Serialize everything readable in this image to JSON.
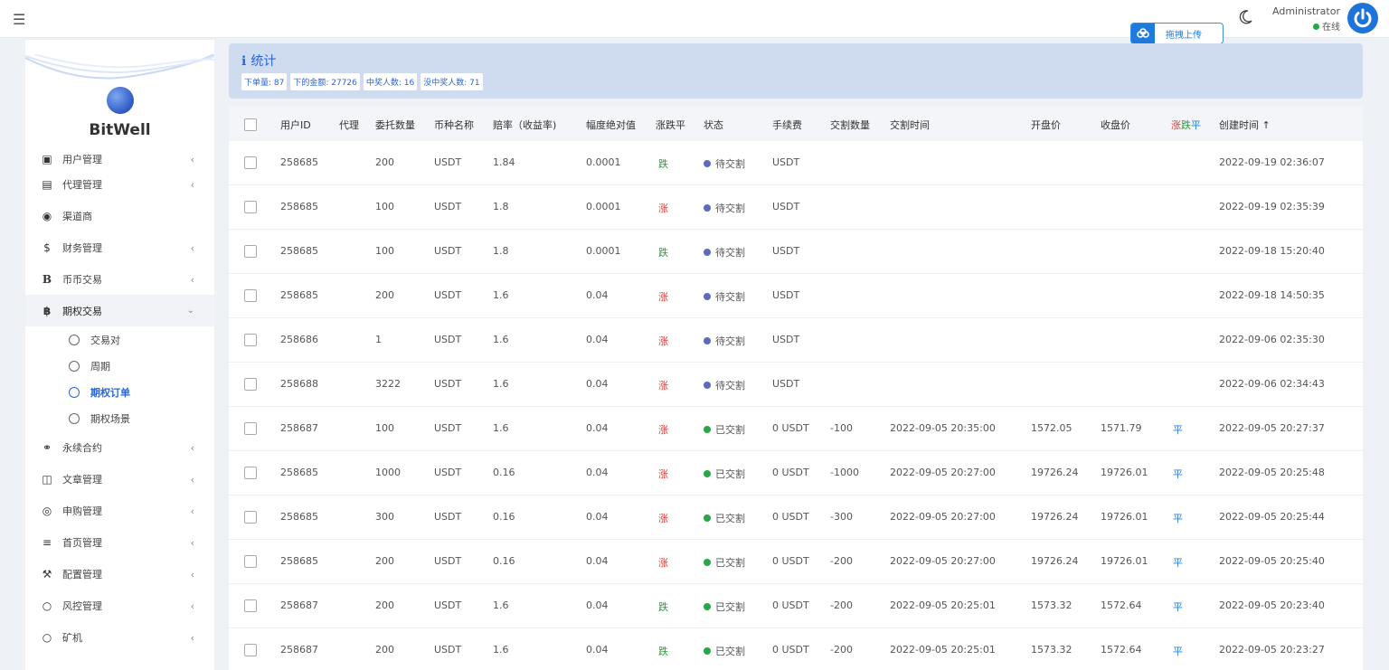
{
  "topbar": {
    "menu_icon": "hamburger-icon",
    "upload_label": "拖拽上传",
    "admin_name": "Administrator",
    "admin_status": "在线"
  },
  "brand": {
    "name": "BitWell"
  },
  "menu": [
    {
      "label": "用户管理",
      "icon": "users-icon"
    },
    {
      "label": "代理管理",
      "icon": "id-card-icon"
    },
    {
      "label": "渠道商",
      "icon": "user-circle-icon"
    },
    {
      "label": "财务管理",
      "icon": "dollar-icon"
    },
    {
      "label": "币币交易",
      "icon": "b-icon"
    },
    {
      "label": "期权交易",
      "icon": "bitcoin-icon"
    },
    {
      "label": "永续合约",
      "icon": "link-icon"
    },
    {
      "label": "文章管理",
      "icon": "newspaper-icon"
    },
    {
      "label": "申购管理",
      "icon": "lifebuoy-icon"
    },
    {
      "label": "首页管理",
      "icon": "bars-icon"
    },
    {
      "label": "配置管理",
      "icon": "wrench-icon"
    },
    {
      "label": "风控管理",
      "icon": "circle-icon"
    },
    {
      "label": "矿机",
      "icon": "circle-icon"
    }
  ],
  "submenu": [
    "交易对",
    "周期",
    "期权订单",
    "期权场景"
  ],
  "stats": {
    "title": "统计",
    "badges": [
      "下单量: 87",
      "下的金额: 27726",
      "中奖人数: 16",
      "没中奖人数: 71"
    ]
  },
  "columns": [
    "用户ID",
    "代理",
    "委托数量",
    "币种名称",
    "赔率（收益率)",
    "幅度绝对值",
    "涨跌平",
    "状态",
    "手续费",
    "交割数量",
    "交割时间",
    "开盘价",
    "收盘价",
    "涨",
    "跌",
    "平",
    "创建时间 ↑"
  ],
  "rows": [
    {
      "uid": "258685",
      "qty": "200",
      "coin": "USDT",
      "odds": "1.84",
      "amp": "0.0001",
      "dir": "跌",
      "dir_class": "down",
      "status": "待交割",
      "status_color": "#5c6bc0",
      "fee": "USDT",
      "dqty": "",
      "dtime": "",
      "open": "",
      "close": "",
      "res": "",
      "created": "2022-09-19 02:36:07"
    },
    {
      "uid": "258685",
      "qty": "100",
      "coin": "USDT",
      "odds": "1.8",
      "amp": "0.0001",
      "dir": "涨",
      "dir_class": "up",
      "status": "待交割",
      "status_color": "#5c6bc0",
      "fee": "USDT",
      "dqty": "",
      "dtime": "",
      "open": "",
      "close": "",
      "res": "",
      "created": "2022-09-19 02:35:39"
    },
    {
      "uid": "258685",
      "qty": "100",
      "coin": "USDT",
      "odds": "1.8",
      "amp": "0.0001",
      "dir": "跌",
      "dir_class": "down",
      "status": "待交割",
      "status_color": "#5c6bc0",
      "fee": "USDT",
      "dqty": "",
      "dtime": "",
      "open": "",
      "close": "",
      "res": "",
      "created": "2022-09-18 15:20:40"
    },
    {
      "uid": "258685",
      "qty": "200",
      "coin": "USDT",
      "odds": "1.6",
      "amp": "0.04",
      "dir": "涨",
      "dir_class": "up",
      "status": "待交割",
      "status_color": "#5c6bc0",
      "fee": "USDT",
      "dqty": "",
      "dtime": "",
      "open": "",
      "close": "",
      "res": "",
      "created": "2022-09-18 14:50:35"
    },
    {
      "uid": "258686",
      "qty": "1",
      "coin": "USDT",
      "odds": "1.6",
      "amp": "0.04",
      "dir": "涨",
      "dir_class": "up",
      "status": "待交割",
      "status_color": "#5c6bc0",
      "fee": "USDT",
      "dqty": "",
      "dtime": "",
      "open": "",
      "close": "",
      "res": "",
      "created": "2022-09-06 02:35:30"
    },
    {
      "uid": "258688",
      "qty": "3222",
      "coin": "USDT",
      "odds": "1.6",
      "amp": "0.04",
      "dir": "涨",
      "dir_class": "up",
      "status": "待交割",
      "status_color": "#5c6bc0",
      "fee": "USDT",
      "dqty": "",
      "dtime": "",
      "open": "",
      "close": "",
      "res": "",
      "created": "2022-09-06 02:34:43"
    },
    {
      "uid": "258687",
      "qty": "100",
      "coin": "USDT",
      "odds": "1.6",
      "amp": "0.04",
      "dir": "涨",
      "dir_class": "up",
      "status": "已交割",
      "status_color": "#28a745",
      "fee": "0 USDT",
      "dqty": "-100",
      "dtime": "2022-09-05 20:35:00",
      "open": "1572.05",
      "close": "1571.79",
      "res": "平",
      "created": "2022-09-05 20:27:37"
    },
    {
      "uid": "258685",
      "qty": "1000",
      "coin": "USDT",
      "odds": "0.16",
      "amp": "0.04",
      "dir": "涨",
      "dir_class": "up",
      "status": "已交割",
      "status_color": "#28a745",
      "fee": "0 USDT",
      "dqty": "-1000",
      "dtime": "2022-09-05 20:27:00",
      "open": "19726.24",
      "close": "19726.01",
      "res": "平",
      "created": "2022-09-05 20:25:48"
    },
    {
      "uid": "258685",
      "qty": "300",
      "coin": "USDT",
      "odds": "0.16",
      "amp": "0.04",
      "dir": "涨",
      "dir_class": "up",
      "status": "已交割",
      "status_color": "#28a745",
      "fee": "0 USDT",
      "dqty": "-300",
      "dtime": "2022-09-05 20:27:00",
      "open": "19726.24",
      "close": "19726.01",
      "res": "平",
      "created": "2022-09-05 20:25:44"
    },
    {
      "uid": "258685",
      "qty": "200",
      "coin": "USDT",
      "odds": "0.16",
      "amp": "0.04",
      "dir": "涨",
      "dir_class": "up",
      "status": "已交割",
      "status_color": "#28a745",
      "fee": "0 USDT",
      "dqty": "-200",
      "dtime": "2022-09-05 20:27:00",
      "open": "19726.24",
      "close": "19726.01",
      "res": "平",
      "created": "2022-09-05 20:25:40"
    },
    {
      "uid": "258687",
      "qty": "200",
      "coin": "USDT",
      "odds": "1.6",
      "amp": "0.04",
      "dir": "跌",
      "dir_class": "down",
      "status": "已交割",
      "status_color": "#28a745",
      "fee": "0 USDT",
      "dqty": "-200",
      "dtime": "2022-09-05 20:25:01",
      "open": "1573.32",
      "close": "1572.64",
      "res": "平",
      "created": "2022-09-05 20:23:40"
    },
    {
      "uid": "258687",
      "qty": "200",
      "coin": "USDT",
      "odds": "1.6",
      "amp": "0.04",
      "dir": "跌",
      "dir_class": "down",
      "status": "已交割",
      "status_color": "#28a745",
      "fee": "0 USDT",
      "dqty": "-200",
      "dtime": "2022-09-05 20:25:01",
      "open": "1573.32",
      "close": "1572.64",
      "res": "平",
      "created": "2022-09-05 20:23:27"
    }
  ]
}
